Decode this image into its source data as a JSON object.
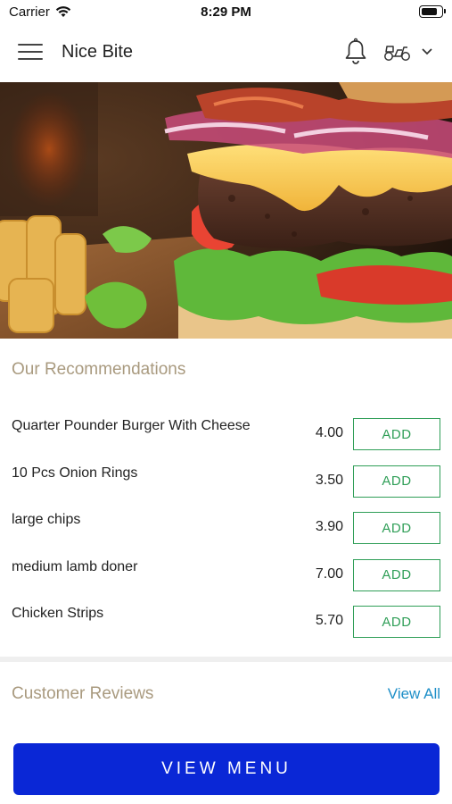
{
  "status_bar": {
    "carrier": "Carrier",
    "time": "8:29 PM",
    "battery_level": 0.85
  },
  "header": {
    "title": "Nice Bite",
    "icons": [
      "menu-icon",
      "bell-icon",
      "scooter-icon",
      "chevron-down-icon"
    ]
  },
  "recommendations": {
    "title": "Our Recommendations",
    "items": [
      {
        "name": "Quarter Pounder Burger With Cheese",
        "price": "4.00",
        "button": "ADD"
      },
      {
        "name": "10 Pcs Onion Rings",
        "price": "3.50",
        "button": "ADD"
      },
      {
        "name": "large chips",
        "price": "3.90",
        "button": "ADD"
      },
      {
        "name": "medium lamb doner",
        "price": "7.00",
        "button": "ADD"
      },
      {
        "name": "Chicken Strips",
        "price": "5.70",
        "button": "ADD"
      }
    ]
  },
  "reviews": {
    "title": "Customer Reviews",
    "view_all": "View All"
  },
  "footer": {
    "view_menu": "VIEW MENU"
  },
  "colors": {
    "accent_green": "#2f9e57",
    "section_title": "#a99a7f",
    "link_blue": "#1e8fc8",
    "primary_button": "#0a27d6"
  }
}
